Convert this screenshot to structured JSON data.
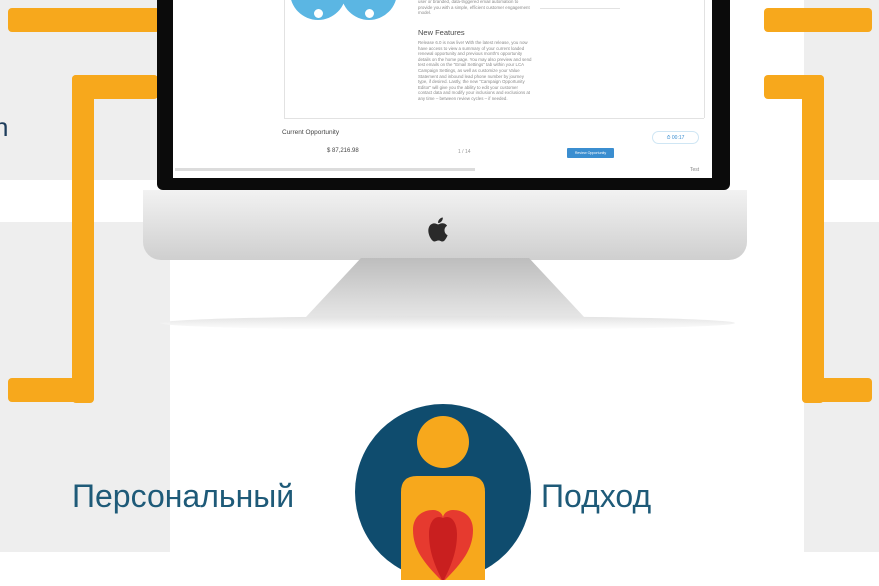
{
  "caption": {
    "left_word": "Персональный",
    "right_word": "Подход"
  },
  "screen": {
    "intro_fragment": "user or branded, data-triggered email automation to provide you with a simple, efficient customer engagement model.",
    "new_features_heading": "New Features",
    "new_features_body": "Release 6.0 is now live! With the latest release, you now have access to view a summary of your current loaded renewal opportunity and previous month's opportunity details on the home page. You may also preview and send test emails on the \"Email Settings\" tab within your LCA Campaign Settings, as well as customize your Value Statement and inbound lead phone number by journey type, if desired. Lastly, the new \"Campaign Opportunity Editor\" will give you the ability to edit your customer contact data and modify your inclusions and exclusions at any time – between review cycles – if needed.",
    "current_opportunity_label": "Current Opportunity",
    "amount": "$ 87,216.98",
    "page_indicator": "1 / 14",
    "review_button": "Review Opportunity",
    "timer": "00:17",
    "test_label": "Test"
  },
  "left_edge_glyph": "n",
  "colors": {
    "bracket": "#f7a81c",
    "caption": "#1e5a78",
    "avatar_bg": "#0f4c6e",
    "person": "#f7a81c",
    "heart": "#e63a2f",
    "screen_accent": "#5bb6e3"
  },
  "icons": [
    "apple-logo-icon",
    "person-heart-icon",
    "timer-icon"
  ]
}
